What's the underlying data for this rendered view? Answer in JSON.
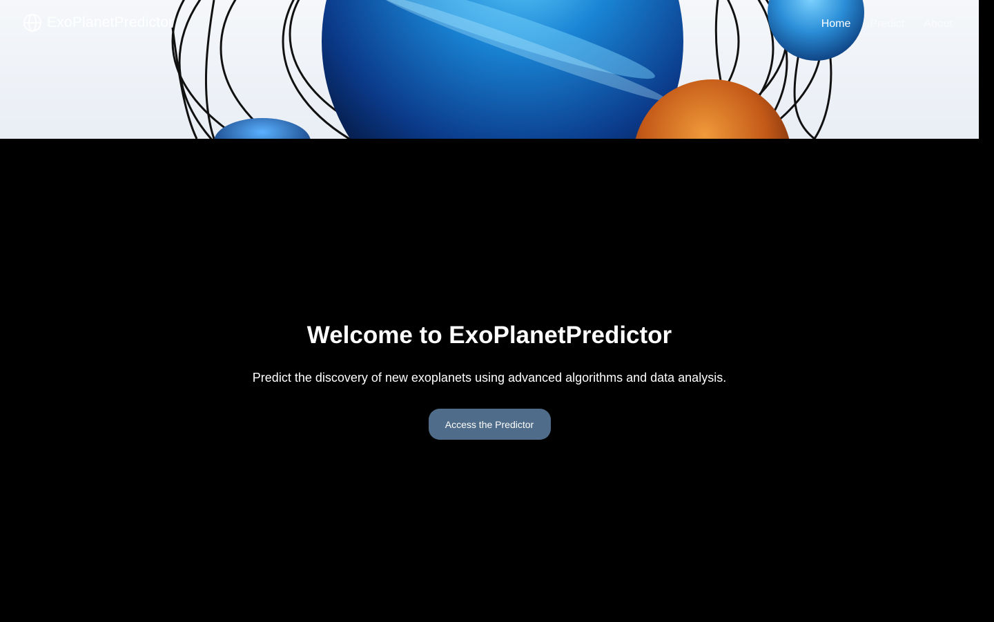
{
  "brand": {
    "name": "ExoPlanetPredictor",
    "logo_icon": "globe-icon"
  },
  "nav": {
    "links": [
      {
        "label": "Home"
      },
      {
        "label": "Predict"
      },
      {
        "label": "About"
      }
    ]
  },
  "hero": {
    "title": "Welcome to ExoPlanetPredictor",
    "subtitle": "Predict the discovery of new exoplanets using advanced algorithms and data analysis.",
    "cta_label": "Access the Predictor"
  },
  "colors": {
    "background": "#000000",
    "cta_button": "#4f6d8a",
    "text": "#ffffff"
  }
}
